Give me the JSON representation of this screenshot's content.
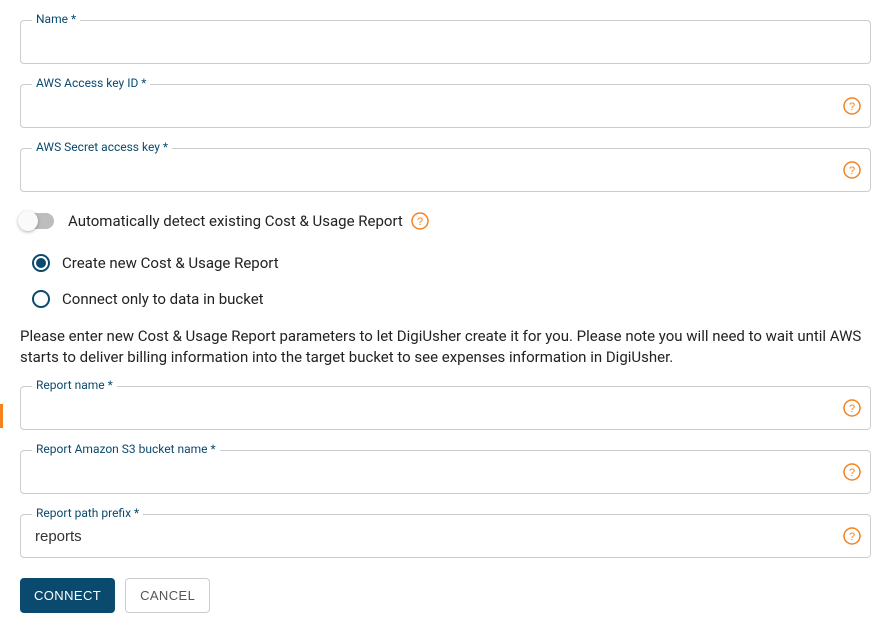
{
  "fields": {
    "name": {
      "label": "Name *",
      "value": ""
    },
    "accessKey": {
      "label": "AWS Access key ID *",
      "value": ""
    },
    "secretKey": {
      "label": "AWS Secret access key *",
      "value": ""
    },
    "reportName": {
      "label": "Report name *",
      "value": ""
    },
    "bucketName": {
      "label": "Report Amazon S3 bucket name *",
      "value": ""
    },
    "pathPrefix": {
      "label": "Report path prefix *",
      "value": "reports"
    }
  },
  "toggle": {
    "label": "Automatically detect existing Cost & Usage Report",
    "enabled": false
  },
  "radio": {
    "create": {
      "label": "Create new Cost & Usage Report",
      "selected": true
    },
    "connect": {
      "label": "Connect only to data in bucket",
      "selected": false
    }
  },
  "desc": "Please enter new Cost & Usage Report parameters to let DigiUsher create it for you. Please note you will need to wait until AWS starts to deliver billing information into the target bucket to see expenses information in DigiUsher.",
  "buttons": {
    "connect": "CONNECT",
    "cancel": "CANCEL"
  }
}
